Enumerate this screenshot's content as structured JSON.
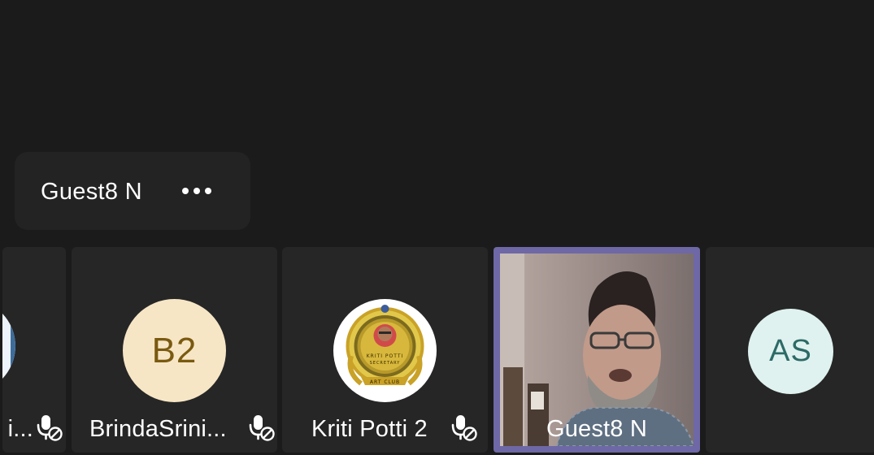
{
  "speaker_chip": {
    "name": "Guest8 N",
    "more_icon": "more-horizontal-icon"
  },
  "participants": [
    {
      "label": "i...",
      "avatar": "image",
      "mic": "mic-off-icon"
    },
    {
      "label": "BrindaSrini...",
      "initials": "B2",
      "avatar_color": "#f7e6c6",
      "initials_color": "#7a5a10",
      "mic": "mic-off-icon"
    },
    {
      "label": "Kriti Potti 2",
      "avatar": "image",
      "mic": "mic-off-icon"
    },
    {
      "label": "Guest8 N",
      "video": true,
      "active_border_color": "#6e68a6"
    },
    {
      "initials": "AS",
      "avatar_color": "#dff2ef",
      "initials_color": "#2d6a66"
    }
  ],
  "logo_text": {
    "line1": "KRITI POTTI",
    "line2": "SECRETARY",
    "banner": "ART CLUB"
  },
  "colors": {
    "background": "#1b1b1b",
    "tile": "#262626",
    "chip": "#232323"
  }
}
